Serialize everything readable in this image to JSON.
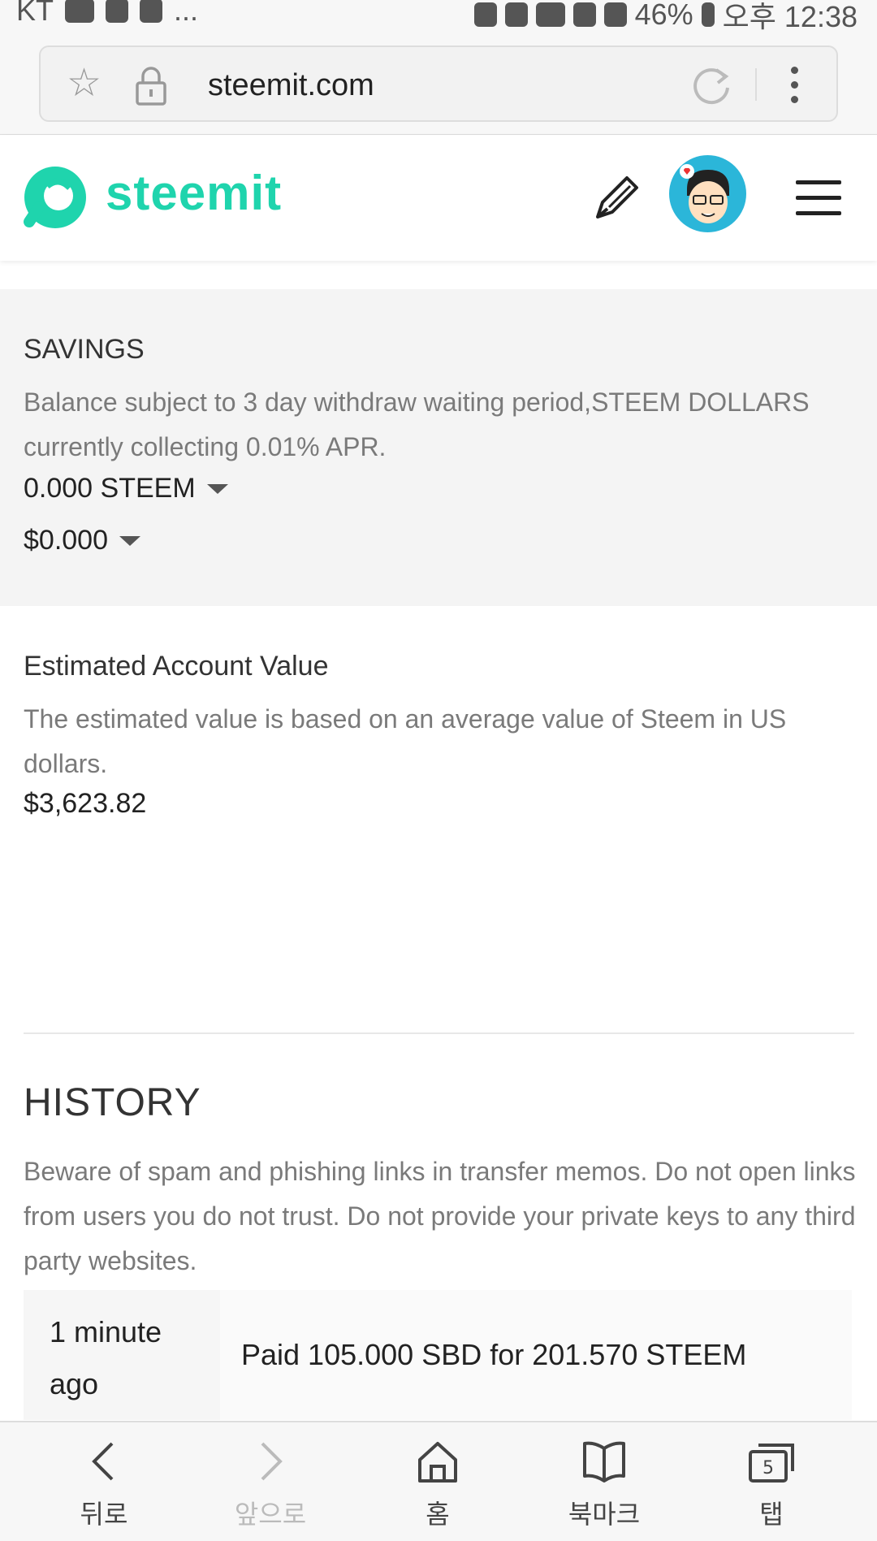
{
  "status_bar": {
    "carrier": "KT",
    "extra": "...",
    "battery": "46%",
    "time": "오후 12:38"
  },
  "browser": {
    "url": "steemit.com"
  },
  "header": {
    "logo_text": "steemit",
    "brand_color": "#1fd4ad"
  },
  "savings": {
    "title": "SAVINGS",
    "description": "Balance subject to 3 day withdraw waiting period,STEEM DOLLARS currently collecting 0.01% APR.",
    "steem_value": "0.000 STEEM",
    "sbd_value": "$0.000"
  },
  "estimated": {
    "title": "Estimated Account Value",
    "description": "The estimated value is based on an average value of Steem in US dollars.",
    "value": "$3,623.82"
  },
  "history": {
    "title": "HISTORY",
    "warning": "Beware of spam and phishing links in transfer memos. Do not open links from users you do not trust. Do not provide your private keys to any third party websites.",
    "rows": [
      {
        "time": "1 minute ago",
        "description": "Paid 105.000 SBD for 201.570 STEEM"
      }
    ]
  },
  "bottom_nav": {
    "back": "뒤로",
    "forward": "앞으로",
    "home": "홈",
    "bookmarks": "북마크",
    "tabs": "탭",
    "tab_count": "5"
  }
}
